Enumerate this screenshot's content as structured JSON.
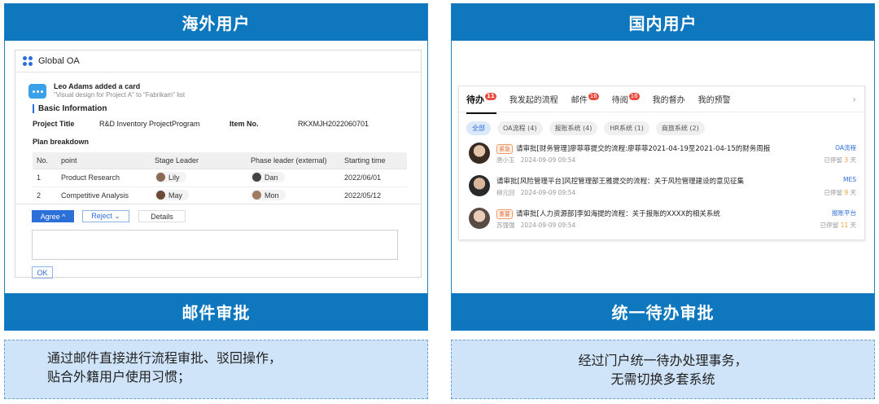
{
  "left": {
    "header": "海外用户",
    "footer": "邮件审批",
    "desc_line1": "通过邮件直接进行流程审批、驳回操作，",
    "desc_line2": "贴合外籍用户使用习惯；",
    "mail": {
      "app_name": "Global OA",
      "card_title": "Leo Adams added a card",
      "card_sub": "\"Visual design for Project A\" to \"Fabrikam\" list",
      "section": "Basic Information",
      "project_title_label": "Project Title",
      "project_title_value": "R&D Inventory ProjectProgram",
      "item_no_label": "Item No.",
      "item_no_value": "RKXMJH2022060701",
      "plan_label": "Plan breakdown",
      "columns": [
        "No.",
        "point",
        "Stage Leader",
        "Phase leader (external)",
        "Starting time"
      ],
      "rows": [
        {
          "no": "1",
          "point": "Product Research",
          "stage": "Lily",
          "phase": "Dan",
          "start": "2022/06/01"
        },
        {
          "no": "2",
          "point": "Competitive Analysis",
          "stage": "May",
          "phase": "Mon",
          "start": "2022/05/12"
        }
      ],
      "agree": "Agree ^",
      "reject": "Reject ⌄",
      "details": "Details",
      "ok": "OK"
    }
  },
  "right": {
    "header": "国内用户",
    "footer": "统一待办审批",
    "desc_line1": "经过门户统一待办处理事务，",
    "desc_line2": "无需切换多套系统",
    "tabs": [
      {
        "label": "待办",
        "badge": "11"
      },
      {
        "label": "我发起的流程",
        "badge": ""
      },
      {
        "label": "邮件",
        "badge": "16"
      },
      {
        "label": "待阅",
        "badge": "16"
      },
      {
        "label": "我的督办",
        "badge": ""
      },
      {
        "label": "我的预警",
        "badge": ""
      }
    ],
    "arrow": "›",
    "chips": [
      "全部",
      "OA流程 (4)",
      "报账系统 (4)",
      "HR系统 (1)",
      "商旅系统 (2)"
    ],
    "items": [
      {
        "tag": "紧急",
        "title": "请审批[财务管理]廖菲菲提交的流程:廖菲菲2021-04-19至2021-04-15的财务周报",
        "person": "唐小玉",
        "time": "2024-09-09  09:54",
        "system": "OA流程",
        "stay_prefix": "已停留",
        "days": "3",
        "stay_suffix": "天"
      },
      {
        "tag": "",
        "title": "请审批[风险管理平台]风控管理部王雅提交的流程：关于风险管理建设的意见征集",
        "person": "柳元回",
        "time": "2024-09-09  09:54",
        "system": "MES",
        "stay_prefix": "已停留",
        "days": "9",
        "stay_suffix": "天"
      },
      {
        "tag": "重要",
        "title": "请审批[人力资源部]李如海提的流程：关于报账的XXXX的相关系统",
        "person": "苏强强",
        "time": "2024-09-09  09:54",
        "system": "报账平台",
        "stay_prefix": "已停留",
        "days": "11",
        "stay_suffix": "天"
      }
    ]
  }
}
